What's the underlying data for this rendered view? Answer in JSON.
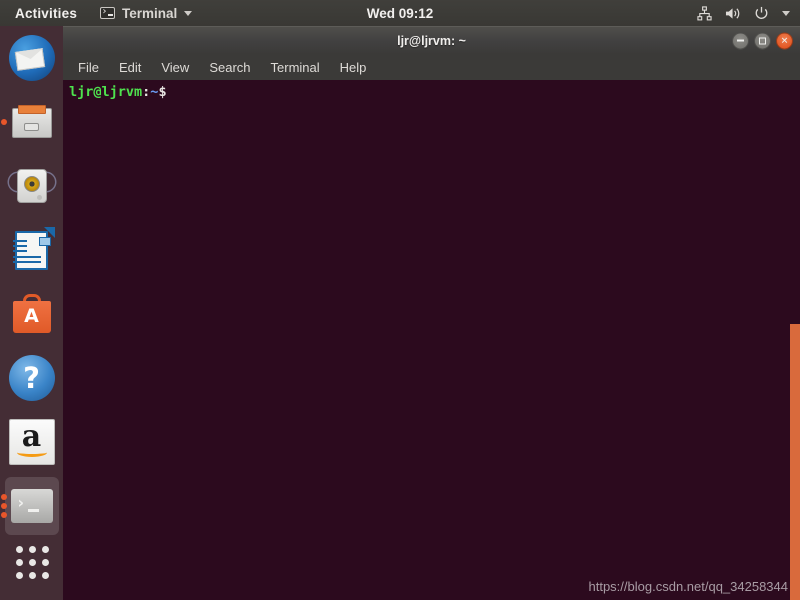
{
  "top_bar": {
    "activities_label": "Activities",
    "app_name": "Terminal",
    "app_icon": "terminal-icon",
    "app_menu_caret": "chevron-down-icon",
    "clock": "Wed 09:12",
    "indicators": [
      {
        "name": "network-icon",
        "label": "network"
      },
      {
        "name": "volume-icon",
        "label": "volume"
      },
      {
        "name": "power-icon",
        "label": "power"
      },
      {
        "name": "chevron-down-icon",
        "label": "system menu"
      }
    ]
  },
  "dock": {
    "items": [
      {
        "name": "thunderbird",
        "label": "Thunderbird Mail",
        "running": false,
        "active": false
      },
      {
        "name": "files",
        "label": "Files",
        "running": true,
        "active": false
      },
      {
        "name": "rhythmbox",
        "label": "Rhythmbox",
        "running": false,
        "active": false
      },
      {
        "name": "libreoffice-writer",
        "label": "LibreOffice Writer",
        "running": false,
        "active": false
      },
      {
        "name": "ubuntu-software",
        "label": "Ubuntu Software",
        "running": false,
        "active": false
      },
      {
        "name": "help",
        "label": "Help",
        "running": false,
        "active": false
      },
      {
        "name": "amazon",
        "label": "Amazon",
        "running": false,
        "active": false
      },
      {
        "name": "terminal",
        "label": "Terminal",
        "running": true,
        "active": true
      }
    ],
    "amazon_letter": "a",
    "software_letter": "A",
    "help_glyph": "?",
    "show_apps_label": "Show Applications"
  },
  "window": {
    "title": "ljr@ljrvm: ~",
    "buttons": {
      "minimize": "minimize-button",
      "maximize": "maximize-button",
      "close": "close-button"
    },
    "menu": [
      {
        "label": "File"
      },
      {
        "label": "Edit"
      },
      {
        "label": "View"
      },
      {
        "label": "Search"
      },
      {
        "label": "Terminal"
      },
      {
        "label": "Help"
      }
    ]
  },
  "terminal": {
    "prompt_user": "ljr@ljrvm",
    "prompt_colon": ":",
    "prompt_path": "~",
    "prompt_symbol": "$",
    "command": "",
    "background_color": "#2c0a1e",
    "scrollbar_color": "#d96a3c"
  },
  "watermark": {
    "text": "https://blog.csdn.net/qq_34258344"
  }
}
